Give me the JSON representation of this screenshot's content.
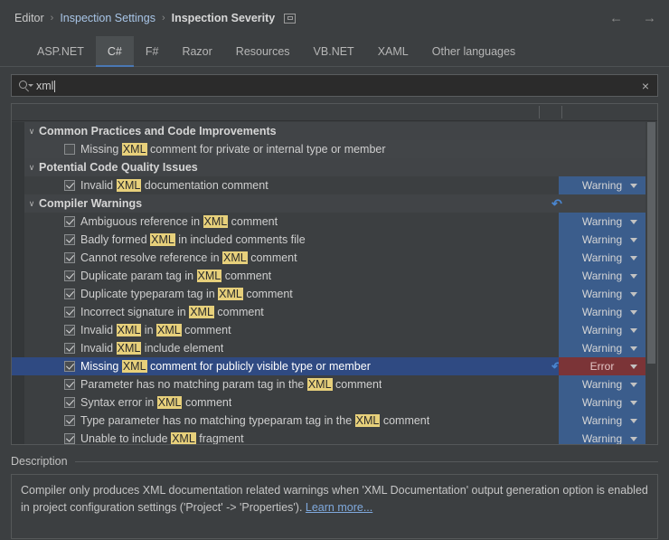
{
  "breadcrumb": {
    "items": [
      "Editor",
      "Inspection Settings",
      "Inspection Severity"
    ],
    "separator": "›",
    "badge_icon": "window-icon"
  },
  "nav": {
    "back_icon": "←",
    "forward_icon": "→"
  },
  "tabs": [
    {
      "label": "ASP.NET",
      "active": false
    },
    {
      "label": "C#",
      "active": true
    },
    {
      "label": "F#",
      "active": false
    },
    {
      "label": "Razor",
      "active": false
    },
    {
      "label": "Resources",
      "active": false
    },
    {
      "label": "VB.NET",
      "active": false
    },
    {
      "label": "XAML",
      "active": false
    },
    {
      "label": "Other languages",
      "active": false
    }
  ],
  "search": {
    "value": "xml",
    "placeholder": "",
    "icon": "search-icon",
    "clear_icon": "×"
  },
  "tree": {
    "highlight_term": "XML",
    "collapse_icon": "∨",
    "revert_icon": "↶",
    "dropdown_icon": "chevron-down-icon",
    "rows": [
      {
        "type": "group",
        "label": "Common Practices and Code Improvements",
        "expanded": true
      },
      {
        "type": "leaf",
        "label": "Missing XML comment for private or internal type or member",
        "checked": false,
        "severity": null,
        "selected": false,
        "revert": false,
        "alt": true
      },
      {
        "type": "group",
        "label": "Potential Code Quality Issues",
        "expanded": true
      },
      {
        "type": "leaf",
        "label": "Invalid XML documentation comment",
        "checked": true,
        "severity": "Warning",
        "selected": false,
        "revert": false,
        "alt": false
      },
      {
        "type": "group",
        "label": "Compiler Warnings",
        "expanded": true,
        "revert": true
      },
      {
        "type": "leaf",
        "label": "Ambiguous reference in XML comment",
        "checked": true,
        "severity": "Warning",
        "selected": false,
        "revert": false,
        "alt": false
      },
      {
        "type": "leaf",
        "label": "Badly formed XML in included comments file",
        "checked": true,
        "severity": "Warning",
        "selected": false,
        "revert": false,
        "alt": false
      },
      {
        "type": "leaf",
        "label": "Cannot resolve reference in XML comment",
        "checked": true,
        "severity": "Warning",
        "selected": false,
        "revert": false,
        "alt": false
      },
      {
        "type": "leaf",
        "label": "Duplicate param tag in XML comment",
        "checked": true,
        "severity": "Warning",
        "selected": false,
        "revert": false,
        "alt": false
      },
      {
        "type": "leaf",
        "label": "Duplicate typeparam tag in XML comment",
        "checked": true,
        "severity": "Warning",
        "selected": false,
        "revert": false,
        "alt": false
      },
      {
        "type": "leaf",
        "label": "Incorrect signature in XML comment",
        "checked": true,
        "severity": "Warning",
        "selected": false,
        "revert": false,
        "alt": false
      },
      {
        "type": "leaf",
        "label": "Invalid XML in XML comment",
        "checked": true,
        "severity": "Warning",
        "selected": false,
        "revert": false,
        "alt": false
      },
      {
        "type": "leaf",
        "label": "Invalid XML include element",
        "checked": true,
        "severity": "Warning",
        "selected": false,
        "revert": false,
        "alt": false
      },
      {
        "type": "leaf",
        "label": "Missing XML comment for publicly visible type or member",
        "checked": true,
        "severity": "Error",
        "selected": true,
        "revert": true,
        "alt": false
      },
      {
        "type": "leaf",
        "label": "Parameter has no matching param tag in the XML comment",
        "checked": true,
        "severity": "Warning",
        "selected": false,
        "revert": false,
        "alt": false
      },
      {
        "type": "leaf",
        "label": "Syntax error in XML comment",
        "checked": true,
        "severity": "Warning",
        "selected": false,
        "revert": false,
        "alt": false
      },
      {
        "type": "leaf",
        "label": "Type parameter has no matching typeparam tag in the XML comment",
        "checked": true,
        "severity": "Warning",
        "selected": false,
        "revert": false,
        "alt": false
      },
      {
        "type": "leaf",
        "label": "Unable to include XML fragment",
        "checked": true,
        "severity": "Warning",
        "selected": false,
        "revert": false,
        "alt": false
      }
    ]
  },
  "description": {
    "title": "Description",
    "text": "Compiler only produces XML documentation related warnings when 'XML Documentation' output generation option is enabled in project configuration settings ('Project' -> 'Properties'). ",
    "link_label": "Learn more..."
  },
  "colors": {
    "background": "#3c3f41",
    "warning": "#3b5d8c",
    "error": "#7b3437",
    "selection": "#2f4a82",
    "highlight": "#e7d07b",
    "accent": "#4a78b4",
    "link": "#7fa9dd"
  }
}
